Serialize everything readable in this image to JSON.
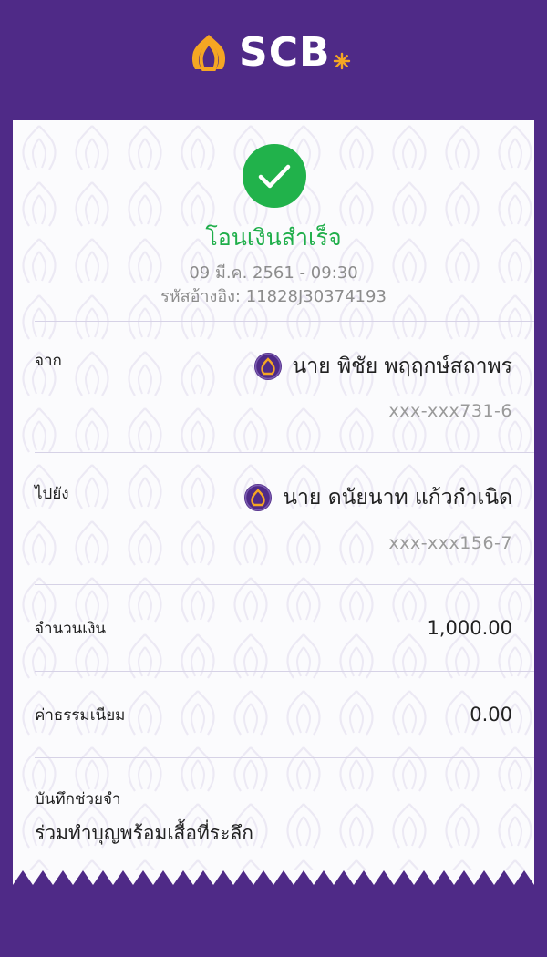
{
  "brand": {
    "name": "SCB",
    "icon": "scb-temple-logo",
    "accent_color": "#4f2a87",
    "gold_color": "#f5a623"
  },
  "status": {
    "icon": "check-icon",
    "title": "โอนเงินสำเร็จ",
    "date": "09 มี.ค. 2561 - 09:30",
    "reference": "รหัสอ้างอิง: 11828J30374193",
    "color": "#1fae4a"
  },
  "from": {
    "label": "จาก",
    "name": "นาย พิชัย พฤฤกษ์สถาพร",
    "account": "xxx-xxx731-6",
    "icon": "scb-bank-icon"
  },
  "to": {
    "label": "ไปยัง",
    "name": "นาย ดนัยนาท แก้วกำเนิด",
    "account": "xxx-xxx156-7",
    "icon": "scb-bank-icon"
  },
  "amount": {
    "label": "จำนวนเงิน",
    "value": "1,000.00"
  },
  "fee": {
    "label": "ค่าธรรมเนียม",
    "value": "0.00"
  },
  "memo": {
    "label": "บันทึกช่วยจำ",
    "value": "ร่วมทำบุญพร้อมเสื้อที่ระลึก"
  }
}
